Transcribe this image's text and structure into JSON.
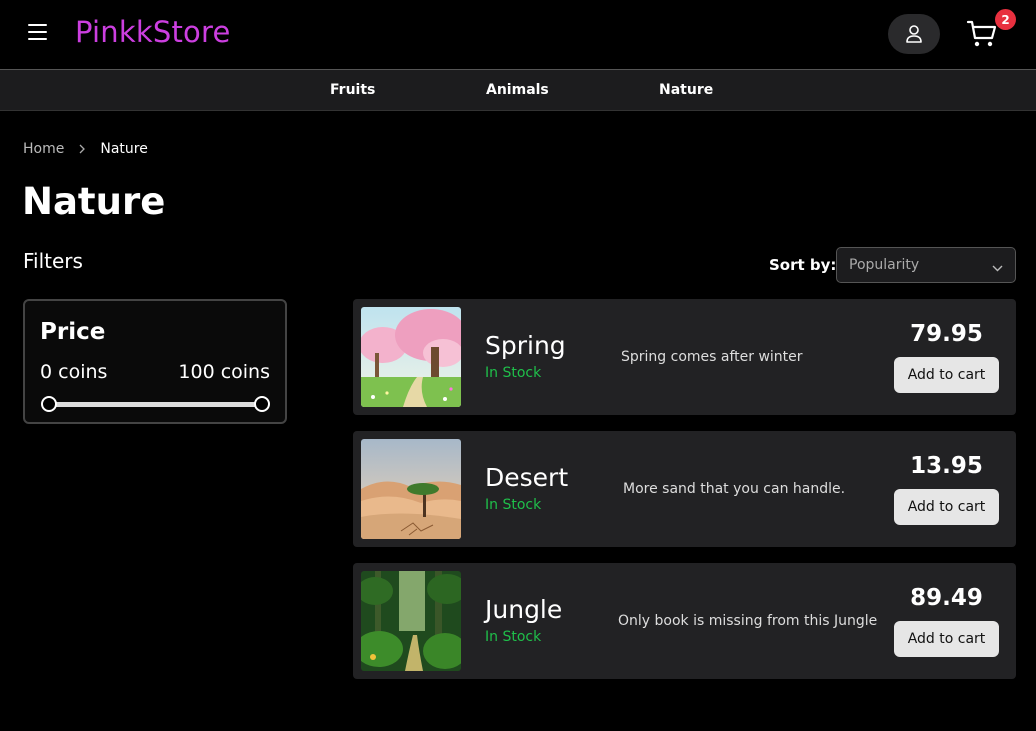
{
  "header": {
    "logo": "PinkkStore",
    "cart_count": "2",
    "menu_icon": "hamburger-menu-icon",
    "user_icon": "user-icon",
    "cart_icon": "shopping-cart-icon"
  },
  "nav": {
    "items": [
      {
        "label": "Fruits"
      },
      {
        "label": "Animals"
      },
      {
        "label": "Nature"
      }
    ]
  },
  "breadcrumb": {
    "home": "Home",
    "current": "Nature"
  },
  "page": {
    "title": "Nature"
  },
  "filters": {
    "title": "Filters",
    "price_label": "Price",
    "min_label": "0 coins",
    "max_label": "100 coins"
  },
  "sort": {
    "label": "Sort by:",
    "selected": "Popularity"
  },
  "products": [
    {
      "name": "Spring",
      "stock": "In Stock",
      "description": "Spring comes after winter",
      "price": "79.95",
      "button": "Add to cart"
    },
    {
      "name": "Desert",
      "stock": "In Stock",
      "description": "More sand that you can handle.",
      "price": "13.95",
      "button": "Add to cart"
    },
    {
      "name": "Jungle",
      "stock": "In Stock",
      "description": "Only book is missing from this Jungle",
      "price": "89.49",
      "button": "Add to cart"
    }
  ],
  "colors": {
    "brand": "#cc3fe0",
    "stock_green": "#1fbf4a",
    "badge_red": "#e8303f",
    "card_bg": "#222224"
  }
}
